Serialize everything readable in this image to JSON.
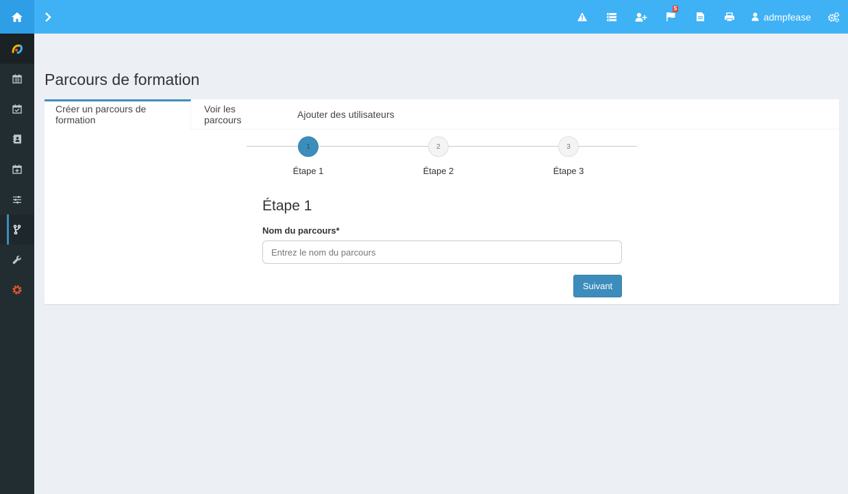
{
  "header": {
    "notifications_count": "5",
    "username": "admpfease"
  },
  "page": {
    "title": "Parcours de formation"
  },
  "tabs": [
    {
      "label": "Créer un parcours de formation",
      "active": true
    },
    {
      "label": "Voir les parcours",
      "active": false
    },
    {
      "label": "Ajouter des utilisateurs",
      "active": false
    }
  ],
  "stepper": {
    "steps": [
      {
        "number": "1",
        "label": "Étape 1",
        "active": true
      },
      {
        "number": "2",
        "label": "Étape 2",
        "active": false
      },
      {
        "number": "3",
        "label": "Étape 3",
        "active": false
      }
    ]
  },
  "form": {
    "heading": "Étape 1",
    "name_label": "Nom du parcours*",
    "name_placeholder": "Entrez le nom du parcours",
    "name_value": "",
    "next_label": "Suivant"
  },
  "colors": {
    "topbar": "#3fb1f5",
    "sidebar": "#222d32",
    "primary": "#3c8dbc",
    "badge": "#dd4b39",
    "gear": "#e8562a"
  },
  "icons": {
    "topbar": [
      "home-icon",
      "chevron-right-icon",
      "warning-icon",
      "list-icon",
      "user-plus-icon",
      "flag-icon",
      "file-icon",
      "print-icon",
      "user-icon",
      "gears-icon"
    ],
    "sidebar": [
      "logo-icon",
      "calendar-icon",
      "calendar-check-icon",
      "address-book-icon",
      "calendar-plus-icon",
      "sliders-icon",
      "code-fork-icon",
      "wrench-icon",
      "gear-icon"
    ]
  }
}
